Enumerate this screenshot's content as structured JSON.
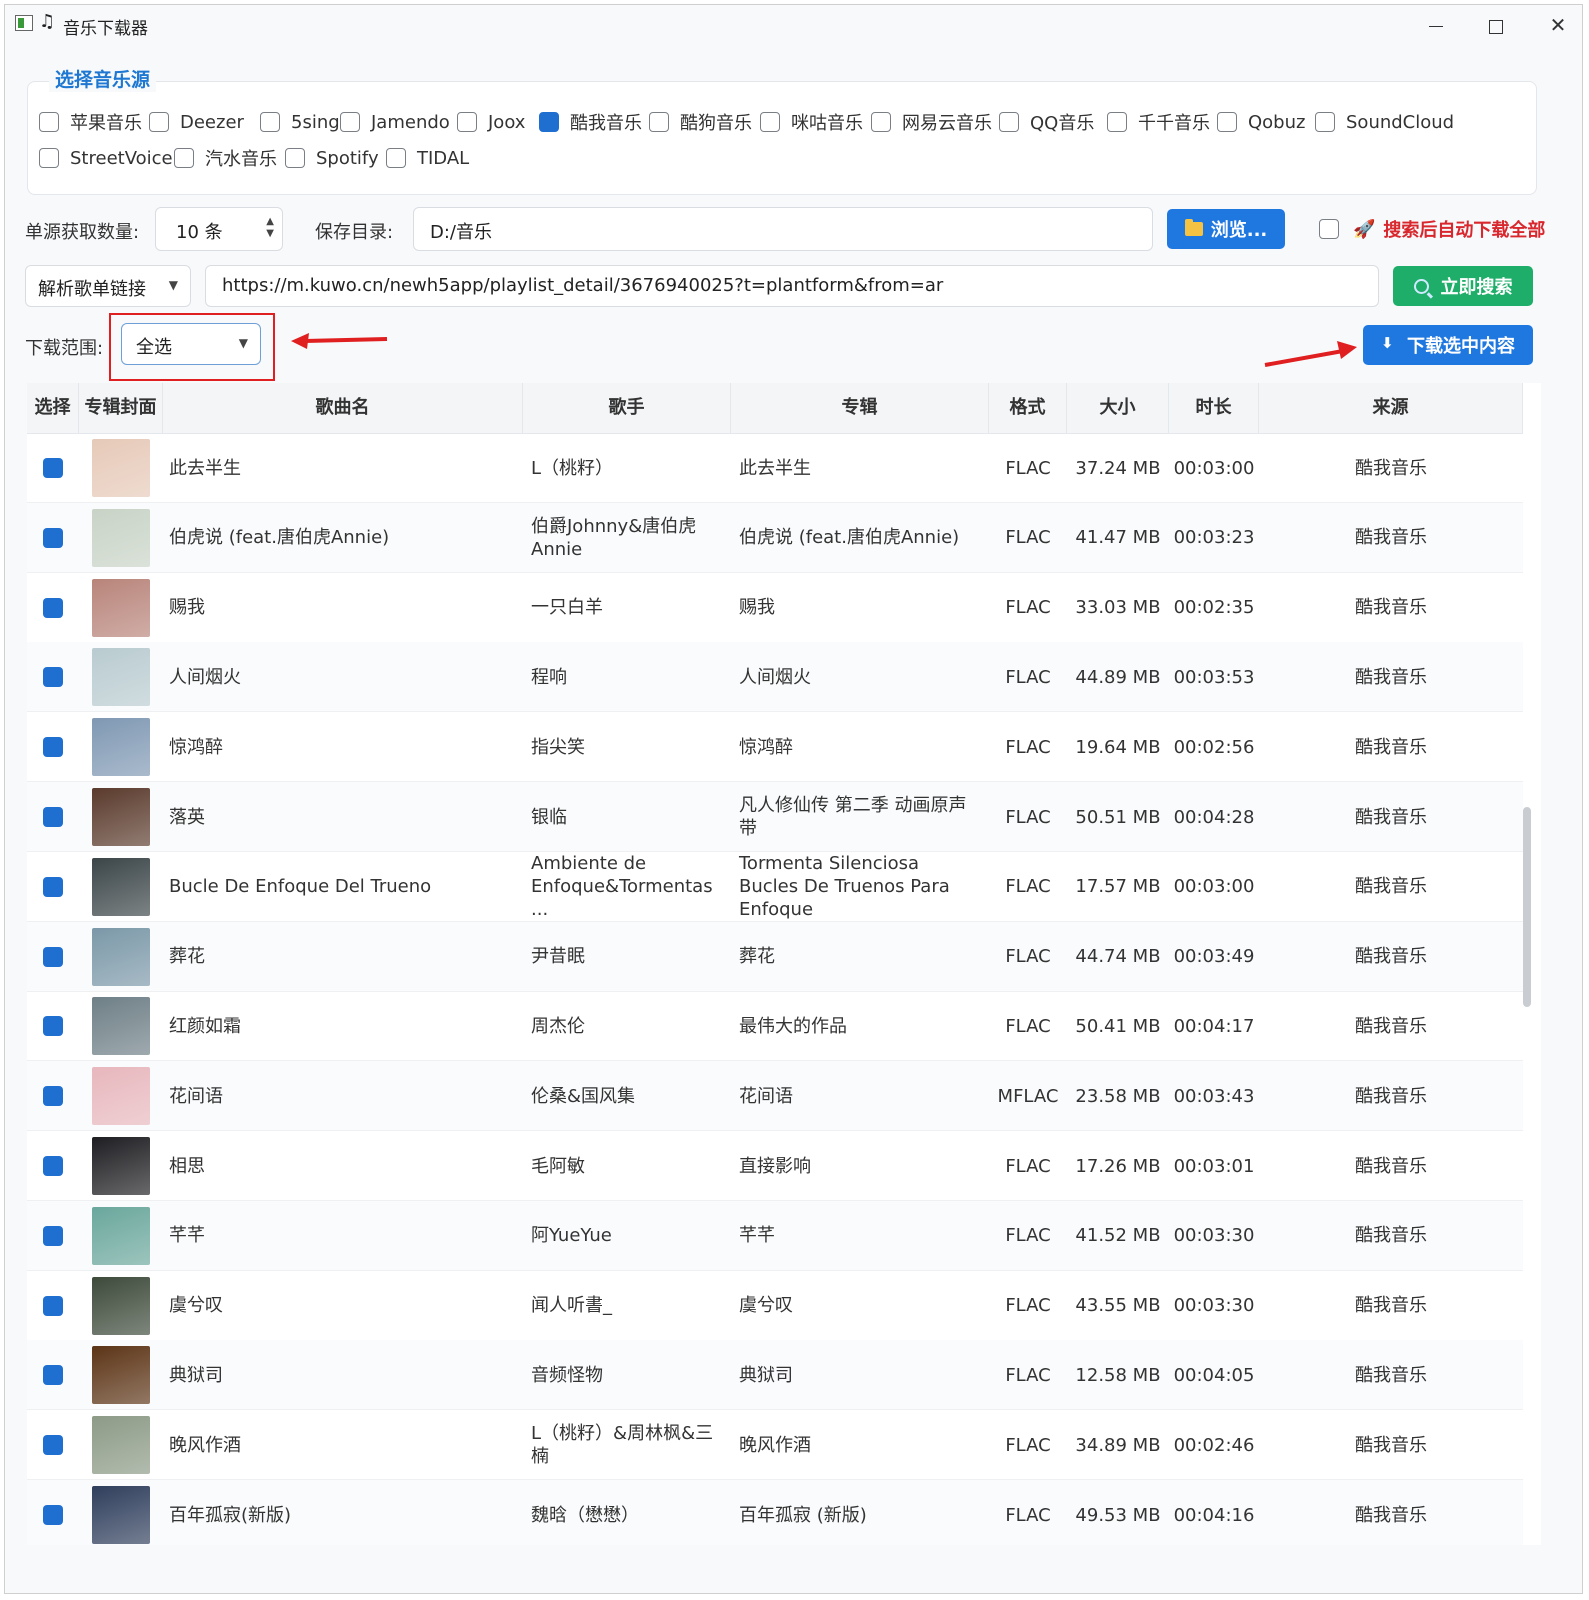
{
  "window": {
    "title": "音乐下载器"
  },
  "source_group": {
    "title": "选择音乐源",
    "sources": [
      {
        "label": "苹果音乐",
        "checked": false
      },
      {
        "label": "Deezer",
        "checked": false
      },
      {
        "label": "5sing",
        "checked": false
      },
      {
        "label": "Jamendo",
        "checked": false
      },
      {
        "label": "Joox",
        "checked": false
      },
      {
        "label": "酷我音乐",
        "checked": true
      },
      {
        "label": "酷狗音乐",
        "checked": false
      },
      {
        "label": "咪咕音乐",
        "checked": false
      },
      {
        "label": "网易云音乐",
        "checked": false
      },
      {
        "label": "QQ音乐",
        "checked": false
      },
      {
        "label": "千千音乐",
        "checked": false
      },
      {
        "label": "Qobuz",
        "checked": false
      },
      {
        "label": "SoundCloud",
        "checked": false
      },
      {
        "label": "StreetVoice",
        "checked": false
      },
      {
        "label": "汽水音乐",
        "checked": false
      },
      {
        "label": "Spotify",
        "checked": false
      },
      {
        "label": "TIDAL",
        "checked": false
      }
    ]
  },
  "settings": {
    "count_label": "单源获取数量:",
    "count_value": "10 条",
    "dir_label": "保存目录:",
    "dir_value": "D:/音乐",
    "browse_label": "浏览...",
    "auto_download_label": "搜索后自动下载全部",
    "auto_download_checked": false
  },
  "search": {
    "mode": "解析歌单链接",
    "url": "https://m.kuwo.cn/newh5app/playlist_detail/3676940025?t=plantform&from=ar",
    "button_label": "立即搜索"
  },
  "range": {
    "label": "下载范围:",
    "value": "全选",
    "download_button_label": "下载选中内容"
  },
  "table": {
    "columns": [
      "选择",
      "专辑封面",
      "歌曲名",
      "歌手",
      "专辑",
      "格式",
      "大小",
      "时长",
      "来源"
    ],
    "rows": [
      {
        "selected": true,
        "cover_color": "#e6c9b8",
        "title": "此去半生",
        "artist": "L（桃籽）",
        "album": "此去半生",
        "format": "FLAC",
        "size": "37.24 MB",
        "duration": "00:03:00",
        "source": "酷我音乐"
      },
      {
        "selected": true,
        "cover_color": "#c8d3c6",
        "title": "伯虎说 (feat.唐伯虎Annie)",
        "artist": "伯爵Johnny&唐伯虎Annie",
        "album": "伯虎说 (feat.唐伯虎Annie)",
        "format": "FLAC",
        "size": "41.47 MB",
        "duration": "00:03:23",
        "source": "酷我音乐"
      },
      {
        "selected": true,
        "cover_color": "#b8847a",
        "title": "赐我",
        "artist": "一只白羊",
        "album": "赐我",
        "format": "FLAC",
        "size": "33.03 MB",
        "duration": "00:02:35",
        "source": "酷我音乐"
      },
      {
        "selected": true,
        "cover_color": "#b9cbd0",
        "title": "人间烟火",
        "artist": "程响",
        "album": "人间烟火",
        "format": "FLAC",
        "size": "44.89 MB",
        "duration": "00:03:53",
        "source": "酷我音乐"
      },
      {
        "selected": true,
        "cover_color": "#7f98b3",
        "title": "惊鸿醉",
        "artist": "指尖笑",
        "album": "惊鸿醉",
        "format": "FLAC",
        "size": "19.64 MB",
        "duration": "00:02:56",
        "source": "酷我音乐"
      },
      {
        "selected": true,
        "cover_color": "#5a3a2c",
        "title": "落英",
        "artist": "银临",
        "album": "凡人修仙传 第二季 动画原声带",
        "format": "FLAC",
        "size": "50.51 MB",
        "duration": "00:04:28",
        "source": "酷我音乐"
      },
      {
        "selected": true,
        "cover_color": "#3b4548",
        "title": "Bucle De Enfoque Del Trueno",
        "artist": "Ambiente de Enfoque&Tormentas ...",
        "album": "Tormenta Silenciosa Bucles De Truenos Para Enfoque",
        "format": "FLAC",
        "size": "17.57 MB",
        "duration": "00:03:00",
        "source": "酷我音乐"
      },
      {
        "selected": true,
        "cover_color": "#7b98a8",
        "title": "葬花",
        "artist": "尹昔眠",
        "album": "葬花",
        "format": "FLAC",
        "size": "44.74 MB",
        "duration": "00:03:49",
        "source": "酷我音乐"
      },
      {
        "selected": true,
        "cover_color": "#6e7f86",
        "title": "红颜如霜",
        "artist": "周杰伦",
        "album": "最伟大的作品",
        "format": "FLAC",
        "size": "50.41 MB",
        "duration": "00:04:17",
        "source": "酷我音乐"
      },
      {
        "selected": true,
        "cover_color": "#e7b7bd",
        "title": "花间语",
        "artist": "伦桑&国风集",
        "album": "花间语",
        "format": "MFLAC",
        "size": "23.58 MB",
        "duration": "00:03:43",
        "source": "酷我音乐"
      },
      {
        "selected": true,
        "cover_color": "#1e1e22",
        "title": "相思",
        "artist": "毛阿敏",
        "album": "直接影响",
        "format": "FLAC",
        "size": "17.26 MB",
        "duration": "00:03:01",
        "source": "酷我音乐"
      },
      {
        "selected": true,
        "cover_color": "#6aa79c",
        "title": "芊芊",
        "artist": "阿YueYue",
        "album": "芊芊",
        "format": "FLAC",
        "size": "41.52 MB",
        "duration": "00:03:30",
        "source": "酷我音乐"
      },
      {
        "selected": true,
        "cover_color": "#3d4a3a",
        "title": "虞兮叹",
        "artist": "闻人听書_",
        "album": "虞兮叹",
        "format": "FLAC",
        "size": "43.55 MB",
        "duration": "00:03:30",
        "source": "酷我音乐"
      },
      {
        "selected": true,
        "cover_color": "#5c3416",
        "title": "典狱司",
        "artist": "音频怪物",
        "album": "典狱司",
        "format": "FLAC",
        "size": "12.58 MB",
        "duration": "00:04:05",
        "source": "酷我音乐"
      },
      {
        "selected": true,
        "cover_color": "#8c9a86",
        "title": "晚风作酒",
        "artist": "L（桃籽）&周林枫&三楠",
        "album": "晚风作酒",
        "format": "FLAC",
        "size": "34.89 MB",
        "duration": "00:02:46",
        "source": "酷我音乐"
      },
      {
        "selected": true,
        "cover_color": "#2f3e5c",
        "title": "百年孤寂(新版)",
        "artist": "魏晗（懋懋）",
        "album": "百年孤寂 (新版)",
        "format": "FLAC",
        "size": "49.53 MB",
        "duration": "00:04:16",
        "source": "酷我音乐"
      }
    ]
  },
  "colors": {
    "accent_blue": "#1f78e0",
    "accent_green": "#1fae6a",
    "warning_red": "#d8282e",
    "annotation_red": "#e02020"
  }
}
